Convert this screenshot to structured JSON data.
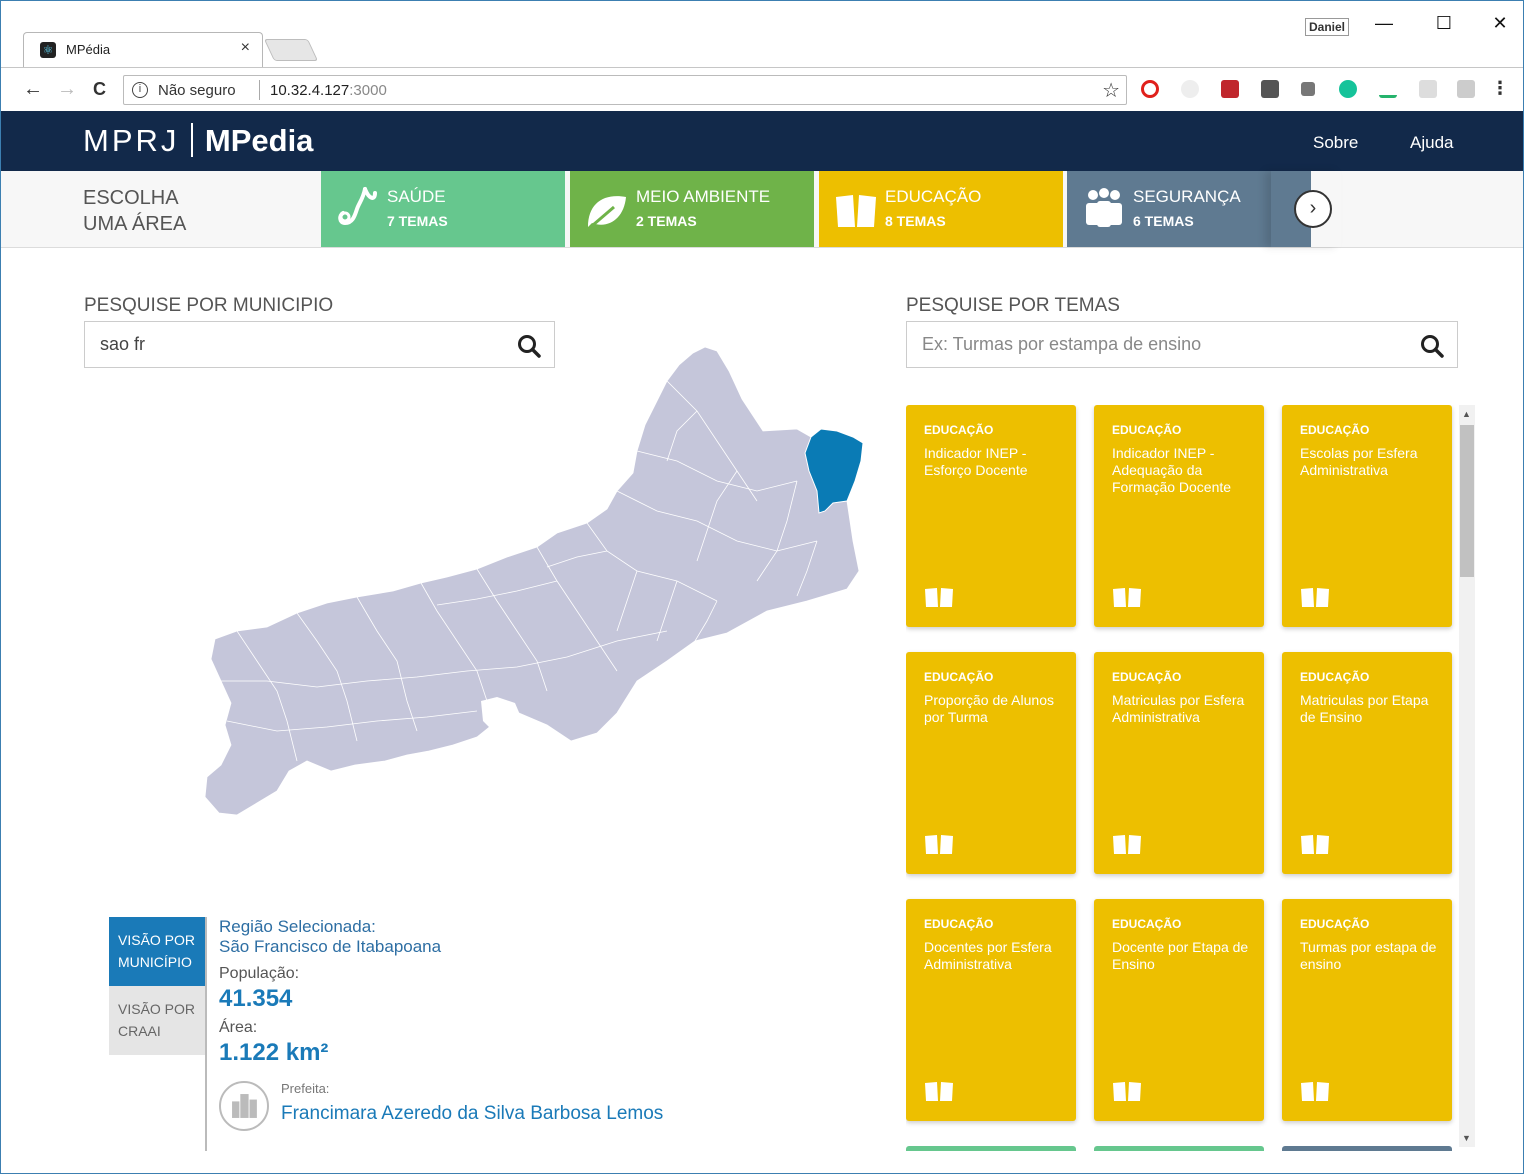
{
  "browser": {
    "tab_title": "MPédia",
    "tab_close": "×",
    "profile_name": "Daniel",
    "security_text": "Não seguro",
    "url_host": "10.32.4.127",
    "url_port": ":3000",
    "window_controls": {
      "minimize": "—",
      "maximize": "☐",
      "close": "✕"
    },
    "nav": {
      "back": "←",
      "forward": "→",
      "reload": "C"
    },
    "menu": "⋮",
    "star": "☆"
  },
  "header": {
    "logo_left": "MPRJ",
    "logo_right": "MPedia",
    "nav": [
      "Sobre",
      "Ajuda"
    ]
  },
  "areas": {
    "label_line1": "ESCOLHA",
    "label_line2": "UMA ÁREA",
    "items": [
      {
        "name": "SAÚDE",
        "count": "7 TEMAS",
        "color": "#66c78e",
        "icon": "stethoscope-icon"
      },
      {
        "name": "MEIO AMBIENTE",
        "count": "2 TEMAS",
        "color": "#6fb349",
        "icon": "leaf-icon"
      },
      {
        "name": "EDUCAÇÃO",
        "count": "8 TEMAS",
        "color": "#edbf00",
        "icon": "book-icon"
      },
      {
        "name": "SEGURANÇA",
        "count": "6 TEMAS",
        "color": "#5f7a91",
        "icon": "people-icon"
      }
    ],
    "next": "›"
  },
  "search_municipio": {
    "label": "PESQUISE POR MUNICIPIO",
    "value": "sao fr"
  },
  "search_temas": {
    "label": "PESQUISE POR TEMAS",
    "placeholder": "Ex: Turmas por estampa de ensino"
  },
  "view_tabs": {
    "municipio": "VISÃO POR MUNICÍPIO",
    "craai": "VISÃO POR CRAAI"
  },
  "info": {
    "region_label": "Região Selecionada:",
    "region_name": "São Francisco de Itabapoana",
    "population_label": "População:",
    "population": "41.354",
    "area_label": "Área:",
    "area": "1.122 km²",
    "mayor_label": "Prefeita:",
    "mayor_name": "Francimara Azeredo da Silva Barbosa Lemos"
  },
  "theme_cards": [
    {
      "category": "EDUCAÇÃO",
      "title": "Indicador INEP - Esforço Docente"
    },
    {
      "category": "EDUCAÇÃO",
      "title": "Indicador INEP - Adequação da Formação Docente"
    },
    {
      "category": "EDUCAÇÃO",
      "title": "Escolas por Esfera Administrativa"
    },
    {
      "category": "EDUCAÇÃO",
      "title": "Proporção de Alunos por Turma"
    },
    {
      "category": "EDUCAÇÃO",
      "title": "Matriculas por Esfera Administrativa"
    },
    {
      "category": "EDUCAÇÃO",
      "title": "Matriculas por Etapa de Ensino"
    },
    {
      "category": "EDUCAÇÃO",
      "title": "Docentes por Esfera Administrativa"
    },
    {
      "category": "EDUCAÇÃO",
      "title": "Docente por Etapa de Ensino"
    },
    {
      "category": "EDUCAÇÃO",
      "title": "Turmas por estapa de ensino"
    }
  ],
  "colors": {
    "header_bg": "#12294a",
    "accent_blue": "#1a7ab8",
    "map_fill": "#c5c6da",
    "map_selected": "#0a7bb5",
    "education": "#edbf00"
  }
}
